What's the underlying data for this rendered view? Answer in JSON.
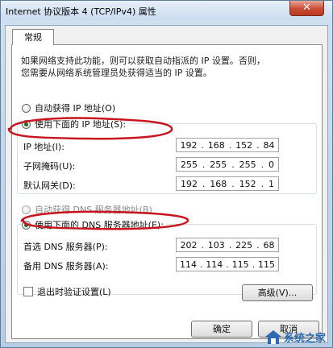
{
  "window": {
    "title": "Internet 协议版本 4 (TCP/IPv4) 属性",
    "close_label": "✕"
  },
  "tab": {
    "label": "常规"
  },
  "description": {
    "line1": "如果网络支持此功能，则可以获取自动指派的 IP 设置。否则，",
    "line2": "您需要从网络系统管理员处获得适当的 IP 设置。"
  },
  "ip_mode": {
    "auto_label": "自动获得 IP 地址(O)",
    "manual_label": "使用下面的 IP 地址(S):",
    "selected": "manual"
  },
  "ip_fields": {
    "ip_address": {
      "label": "IP 地址(I):",
      "octets": [
        "192",
        "168",
        "152",
        "84"
      ]
    },
    "subnet_mask": {
      "label": "子网掩码(U):",
      "octets": [
        "255",
        "255",
        "255",
        "0"
      ]
    },
    "gateway": {
      "label": "默认网关(D):",
      "octets": [
        "192",
        "168",
        "152",
        "1"
      ]
    }
  },
  "dns_mode": {
    "auto_label": "自动获得 DNS 服务器地址(B)",
    "manual_label": "使用下面的 DNS 服务器地址(E):",
    "selected": "manual"
  },
  "dns_fields": {
    "preferred": {
      "label": "首选 DNS 服务器(P):",
      "octets": [
        "202",
        "103",
        "225",
        "68"
      ]
    },
    "alternate": {
      "label": "备用 DNS 服务器(A):",
      "octets": [
        "114",
        "114",
        "115",
        "115"
      ]
    }
  },
  "validate": {
    "label": "退出时验证设置(L)",
    "checked": false
  },
  "buttons": {
    "advanced": "高级(V)...",
    "ok": "确定",
    "cancel": "取消"
  },
  "annotation_color": "#c8141e",
  "watermark": {
    "text": "系统之家"
  }
}
